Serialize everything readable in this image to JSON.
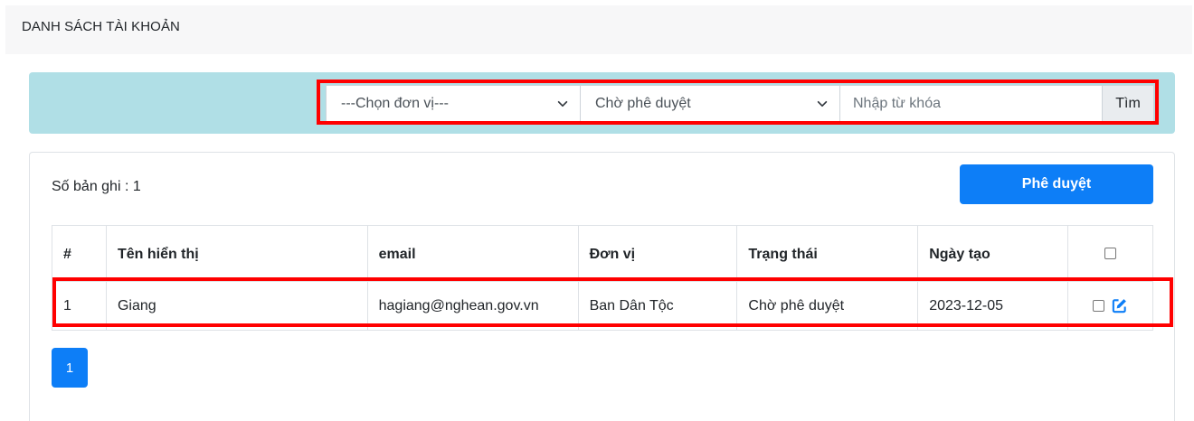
{
  "header": {
    "title": "DANH SÁCH TÀI KHOẢN"
  },
  "filters": {
    "unit_select": {
      "selected": "---Chọn đơn vị---"
    },
    "status_select": {
      "selected": "Chờ phê duyệt"
    },
    "keyword": {
      "placeholder": "Nhập từ khóa",
      "value": ""
    },
    "search_label": "Tìm"
  },
  "list": {
    "record_count_label": "Số bản ghi : 1",
    "approve_label": "Phê duyệt",
    "columns": [
      "#",
      "Tên hiển thị",
      "email",
      "Đơn vị",
      "Trạng thái",
      "Ngày tạo"
    ],
    "rows": [
      {
        "index": "1",
        "display_name": "Giang",
        "email": "hagiang@nghean.gov.vn",
        "unit": "Ban Dân Tộc",
        "status": "Chờ phê duyệt",
        "created": "2023-12-05"
      }
    ]
  },
  "pagination": {
    "current_page": "1"
  },
  "colors": {
    "accent": "#0d7ef7",
    "filter_bar": "#b0dfe6",
    "highlight": "#ff0000"
  },
  "icons": {
    "row_edit": "edit-icon",
    "select_chevron": "chevron-down-icon"
  }
}
